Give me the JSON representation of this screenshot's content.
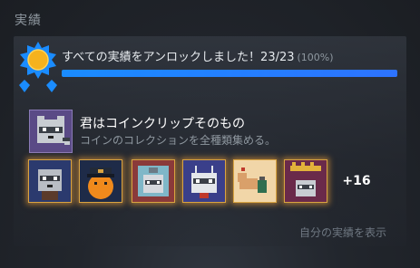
{
  "section": {
    "title": "実績"
  },
  "progress": {
    "text": "すべての実績をアンロックしました！23/23",
    "percent_text": "(100%)",
    "unlocked": 23,
    "total": 23,
    "fraction": 1.0,
    "bar_color": "#2d73ff"
  },
  "featured": {
    "title": "君はコインクリップそのもの",
    "description": "コインのコレクションを全種類集める。",
    "icon": "raccoon-avatar-icon"
  },
  "achievements": [
    {
      "icon": "raccoon-portrait-icon"
    },
    {
      "icon": "orange-police-icon"
    },
    {
      "icon": "raccoon-trash-icon"
    },
    {
      "icon": "robot-raccoon-icon"
    },
    {
      "icon": "arm-potion-icon"
    },
    {
      "icon": "raccoon-crown-icon"
    }
  ],
  "more_count": "+16",
  "show_link": "自分の実績を表示",
  "colors": {
    "accent_glow": "#d9a441",
    "badge_blue": "#1a8cff",
    "badge_sun": "#f5b21e"
  }
}
